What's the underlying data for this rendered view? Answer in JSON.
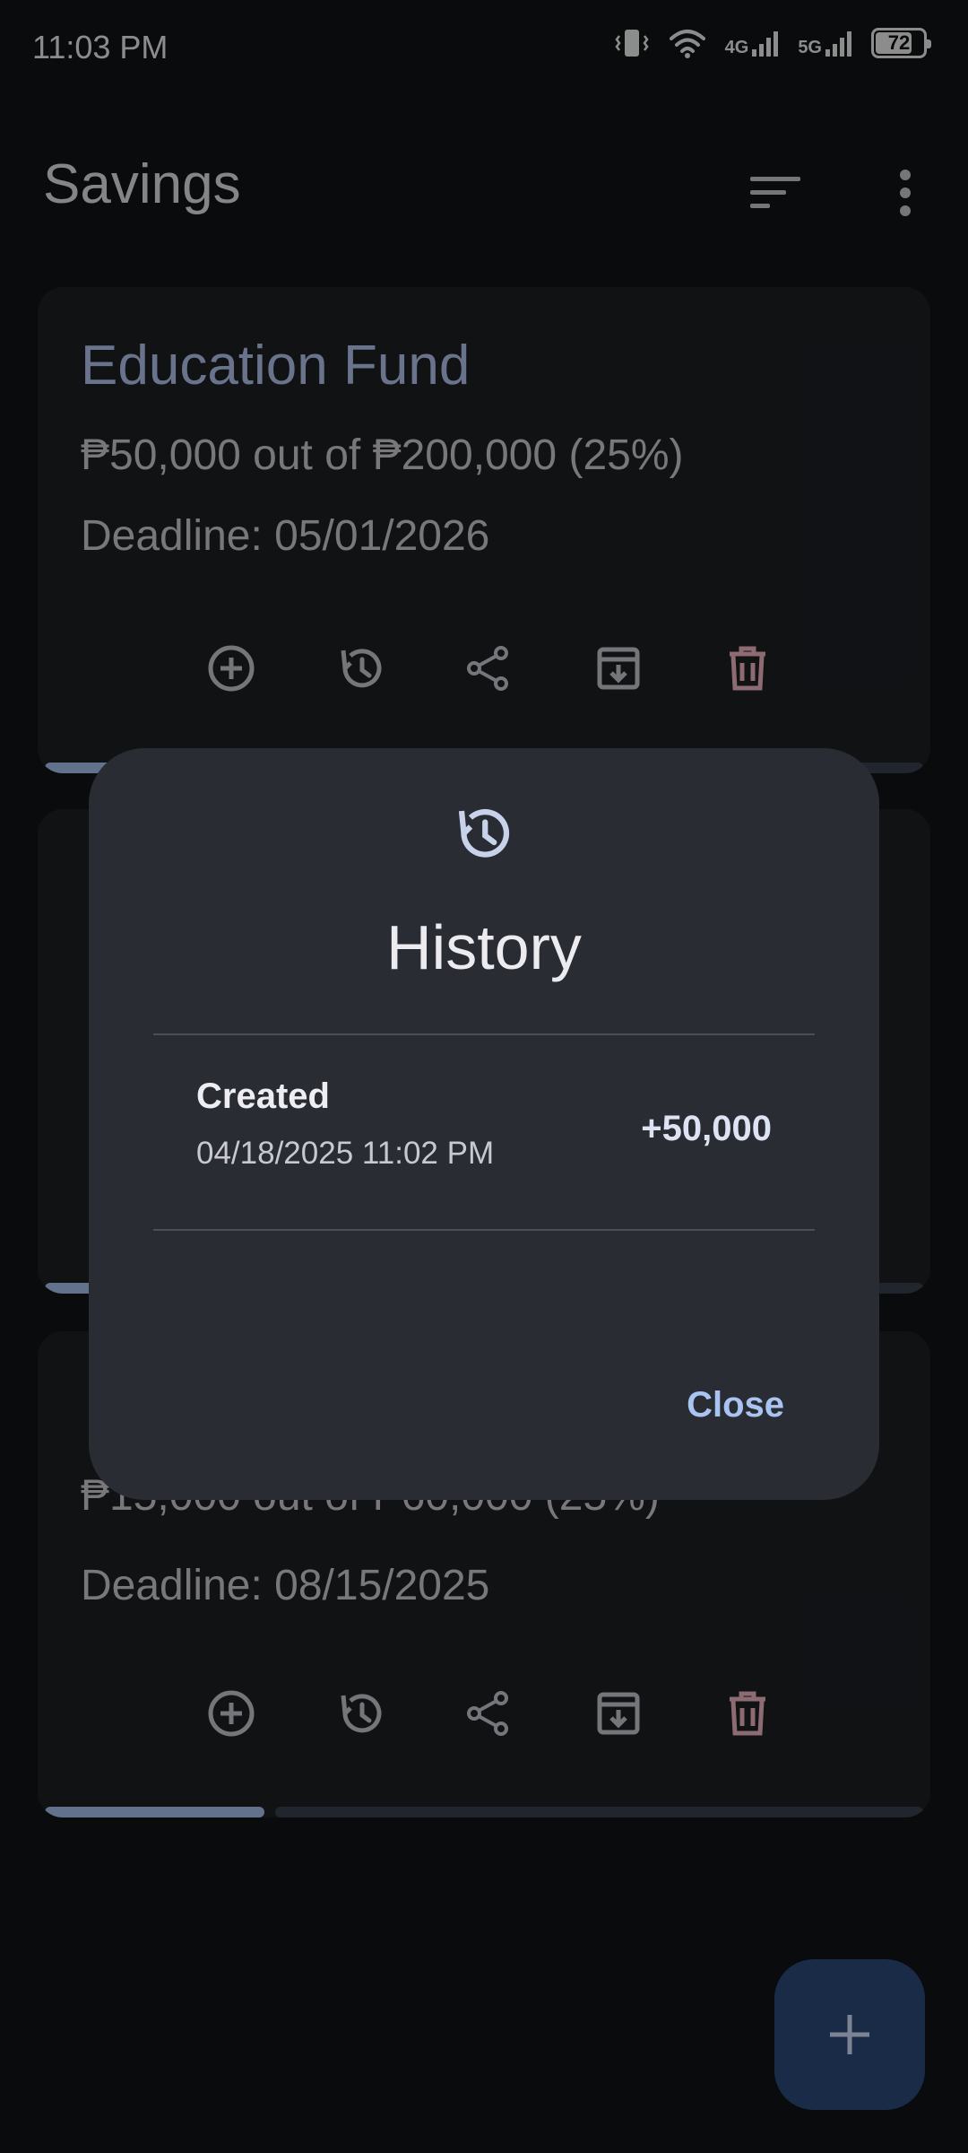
{
  "status_bar": {
    "time": "11:03 PM",
    "network_1": "4G",
    "network_2": "5G",
    "battery": "72",
    "icons": [
      "vibrate-icon",
      "wifi-icon",
      "signal-4g-icon",
      "signal-5g-icon",
      "battery-icon"
    ]
  },
  "app_bar": {
    "title": "Savings",
    "icons": [
      "sort-icon",
      "more-vert-icon"
    ]
  },
  "goals": [
    {
      "name": "Education Fund",
      "amount_text": "₱50,000 out of ₱200,000 (25%)",
      "deadline": "Deadline: 05/01/2026",
      "progress": 0.25
    },
    {
      "name": "",
      "amount_text": "",
      "deadline": "",
      "progress": 0.25
    },
    {
      "name": "",
      "amount_text": "₱15,000 out of ₱60,000 (25%)",
      "deadline": "Deadline: 08/15/2025",
      "progress": 0.25
    }
  ],
  "card_actions": [
    "add-circle-icon",
    "history-icon",
    "share-icon",
    "archive-icon",
    "delete-icon"
  ],
  "dialog": {
    "icon": "history-icon",
    "title": "History",
    "entries": [
      {
        "type": "Created",
        "date": "04/18/2025 11:02 PM",
        "amount": "+50,000"
      }
    ],
    "close_label": "Close"
  },
  "fab": {
    "icon": "add-icon"
  },
  "colors": {
    "accent": "#aac4f2",
    "card_bg": "#1d1f24",
    "dialog_bg": "#2a2c33",
    "delete": "#f2b8c6",
    "fab_bg": "#2e4a7a"
  }
}
